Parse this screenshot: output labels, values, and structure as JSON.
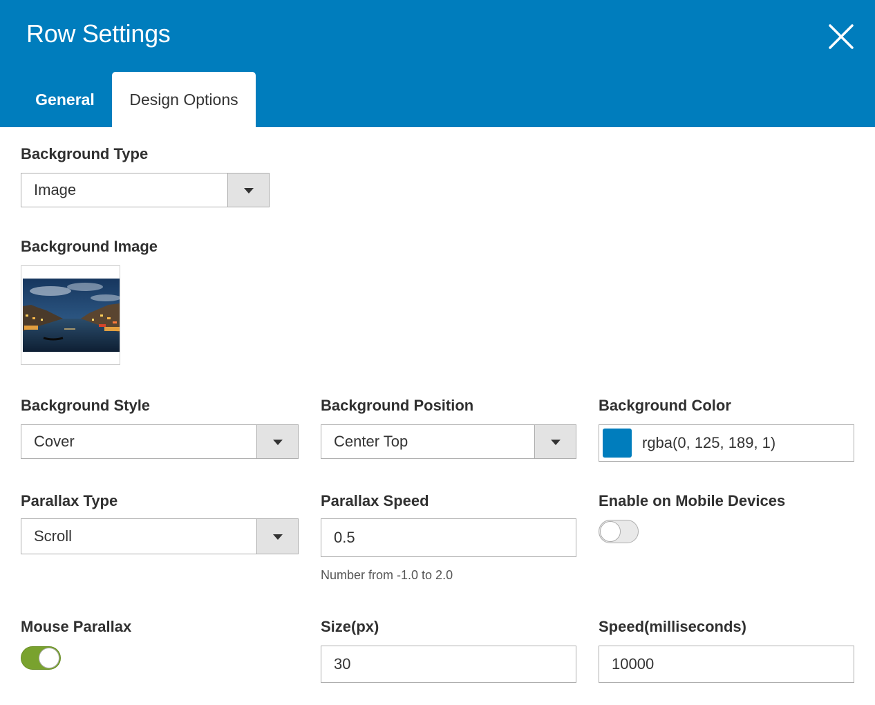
{
  "modal": {
    "title": "Row Settings",
    "close_icon": "close-icon",
    "header_color": "#007dbd"
  },
  "tabs": [
    {
      "label": "General",
      "active": false
    },
    {
      "label": "Design Options",
      "active": true
    }
  ],
  "fields": {
    "background_type": {
      "label": "Background Type",
      "value": "Image"
    },
    "background_image": {
      "label": "Background Image"
    },
    "background_style": {
      "label": "Background Style",
      "value": "Cover"
    },
    "background_position": {
      "label": "Background Position",
      "value": "Center Top"
    },
    "background_color": {
      "label": "Background Color",
      "value": "rgba(0, 125, 189, 1)",
      "swatch": "#007dbd"
    },
    "parallax_type": {
      "label": "Parallax Type",
      "value": "Scroll"
    },
    "parallax_speed": {
      "label": "Parallax Speed",
      "value": "0.5",
      "hint": "Number from -1.0 to 2.0"
    },
    "enable_mobile": {
      "label": "Enable on Mobile Devices",
      "enabled": false
    },
    "mouse_parallax": {
      "label": "Mouse Parallax",
      "enabled": true,
      "on_color": "#79a22e"
    },
    "size": {
      "label": "Size(px)",
      "value": "30"
    },
    "speed": {
      "label": "Speed(milliseconds)",
      "value": "10000"
    }
  }
}
